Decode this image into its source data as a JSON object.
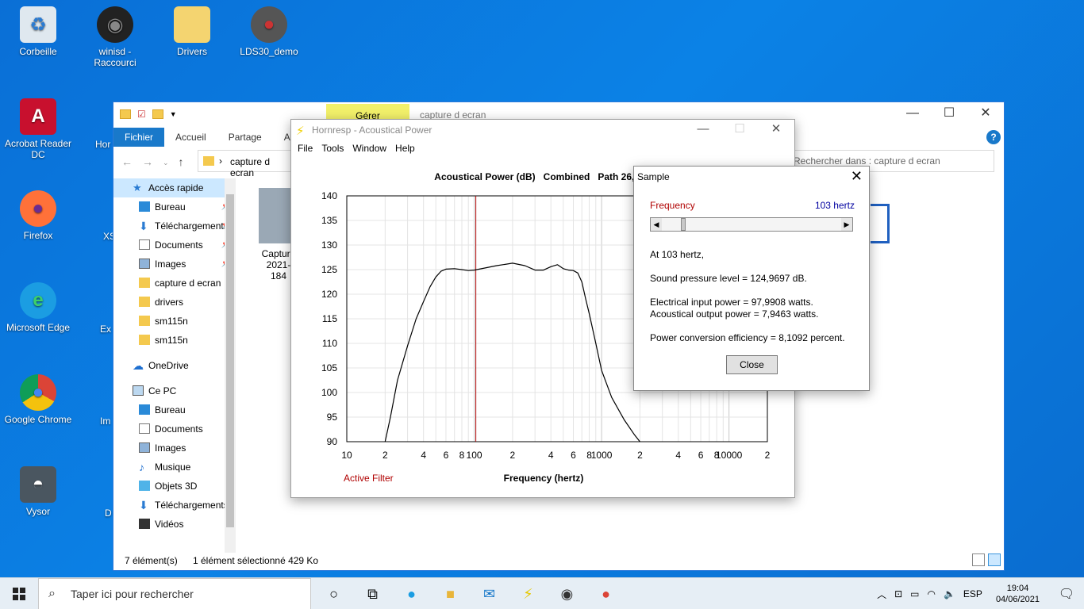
{
  "desktop": {
    "icons": [
      {
        "label": "Corbeille",
        "icon": "recycle-bin-icon"
      },
      {
        "label": "winisd - Raccourci",
        "icon": "speaker-icon"
      },
      {
        "label": "Drivers",
        "icon": "folder-icon"
      },
      {
        "label": "LDS30_demo",
        "icon": "lds-app-icon"
      },
      {
        "label": "Acrobat Reader DC",
        "icon": "acrobat-icon"
      },
      {
        "label": "Firefox",
        "icon": "firefox-icon"
      },
      {
        "label": "Microsoft Edge",
        "icon": "edge-icon"
      },
      {
        "label": "Google Chrome",
        "icon": "chrome-icon"
      },
      {
        "label": "Vysor",
        "icon": "vysor-icon"
      }
    ],
    "partial_labels": [
      "Hor",
      "XS",
      "Ex",
      "Im",
      "D"
    ]
  },
  "explorer": {
    "gerer_tab": "Gérer",
    "title": "capture d ecran",
    "tabs": [
      "Fichier",
      "Accueil",
      "Partage",
      "Affi"
    ],
    "address": "capture d ecran",
    "search_placeholder": "Rechercher dans : capture d ecran",
    "nav_items": [
      {
        "label": "Accès rapide",
        "icon": "star-icon",
        "level": 1,
        "selected": true
      },
      {
        "label": "Bureau",
        "icon": "desktop-icon",
        "pinned": true
      },
      {
        "label": "Téléchargements",
        "icon": "download-icon",
        "pinned": true
      },
      {
        "label": "Documents",
        "icon": "document-icon",
        "pinned": true
      },
      {
        "label": "Images",
        "icon": "image-icon",
        "pinned": true
      },
      {
        "label": "capture d ecran",
        "icon": "folder-icon"
      },
      {
        "label": "drivers",
        "icon": "folder-icon"
      },
      {
        "label": "sm115n",
        "icon": "folder-icon"
      },
      {
        "label": "sm115n",
        "icon": "folder-icon"
      },
      {
        "label": "OneDrive",
        "icon": "cloud-icon",
        "level": 1
      },
      {
        "label": "Ce PC",
        "icon": "computer-icon",
        "level": 1
      },
      {
        "label": "Bureau",
        "icon": "desktop-icon"
      },
      {
        "label": "Documents",
        "icon": "document-icon"
      },
      {
        "label": "Images",
        "icon": "image-icon"
      },
      {
        "label": "Musique",
        "icon": "music-icon"
      },
      {
        "label": "Objets 3D",
        "icon": "cube-icon"
      },
      {
        "label": "Téléchargements",
        "icon": "download-icon"
      },
      {
        "label": "Vidéos",
        "icon": "video-icon"
      }
    ],
    "file": {
      "name_line1": "Capture",
      "name_line2": "2021-",
      "name_line3": "184"
    },
    "status_count": "7 élément(s)",
    "status_selected": "1 élément sélectionné  429 Ko"
  },
  "hornresp": {
    "title": "Hornresp - Acoustical Power",
    "menu": [
      "File",
      "Tools",
      "Window",
      "Help"
    ]
  },
  "chart_data": {
    "type": "line",
    "title": "Acoustical Power (dB)   Combined   Path 26,8 cm",
    "xlabel": "Frequency (hertz)",
    "ylabel": "",
    "x_scale": "log",
    "xlim": [
      10,
      20000
    ],
    "ylim": [
      90,
      140
    ],
    "y_ticks": [
      90,
      95,
      100,
      105,
      110,
      115,
      120,
      125,
      130,
      135,
      140
    ],
    "x_tick_labels": [
      {
        "x": 10,
        "label": "10"
      },
      {
        "x": 20,
        "label": "2"
      },
      {
        "x": 40,
        "label": "4"
      },
      {
        "x": 60,
        "label": "6"
      },
      {
        "x": 80,
        "label": "8"
      },
      {
        "x": 100,
        "label": "100"
      },
      {
        "x": 200,
        "label": "2"
      },
      {
        "x": 400,
        "label": "4"
      },
      {
        "x": 600,
        "label": "6"
      },
      {
        "x": 800,
        "label": "8"
      },
      {
        "x": 1000,
        "label": "1000"
      },
      {
        "x": 2000,
        "label": "2"
      },
      {
        "x": 4000,
        "label": "4"
      },
      {
        "x": 6000,
        "label": "6"
      },
      {
        "x": 8000,
        "label": "8"
      },
      {
        "x": 10000,
        "label": "10000"
      },
      {
        "x": 20000,
        "label": "2"
      }
    ],
    "grid": true,
    "annotation": "Active Filter",
    "cursor_x": 103,
    "series": [
      {
        "color": "#000000",
        "x": [
          20,
          22,
          25,
          30,
          35,
          40,
          45,
          50,
          55,
          60,
          70,
          80,
          90,
          100,
          120,
          150,
          200,
          250,
          300,
          350,
          400,
          450,
          500,
          550,
          600,
          650,
          700,
          750,
          800,
          900,
          1000,
          1200,
          1500,
          1800,
          2000
        ],
        "y": [
          90,
          95,
          102.5,
          109.5,
          115,
          118.5,
          121.5,
          123.5,
          124.7,
          125.1,
          125.2,
          125,
          124.8,
          124.9,
          125.3,
          125.8,
          126.3,
          125.8,
          124.9,
          124.9,
          125.6,
          126,
          125.2,
          124.9,
          124.8,
          124.3,
          122.5,
          119,
          116,
          110,
          104.5,
          99,
          94.5,
          91.5,
          90
        ]
      }
    ]
  },
  "sample": {
    "title": "Sample",
    "freq_label": "Frequency",
    "freq_value": "103 hertz",
    "at_line": "At 103 hertz,",
    "spl_line": "Sound pressure level = 124,9697 dB.",
    "elec_line": "Electrical input power = 97,9908 watts.",
    "acou_line": "Acoustical output power = 7,9463 watts.",
    "eff_line": "Power conversion efficiency = 8,1092 percent.",
    "close_label": "Close"
  },
  "taskbar": {
    "search_placeholder": "Taper ici pour rechercher",
    "lang": "ESP",
    "time": "19:04",
    "date": "04/06/2021"
  },
  "colors": {
    "accent": "#1979ca",
    "desktop": "#0a78dc",
    "cursor": "#aa0000",
    "freq_label": "#b00000",
    "freq_value": "#0000a0"
  }
}
